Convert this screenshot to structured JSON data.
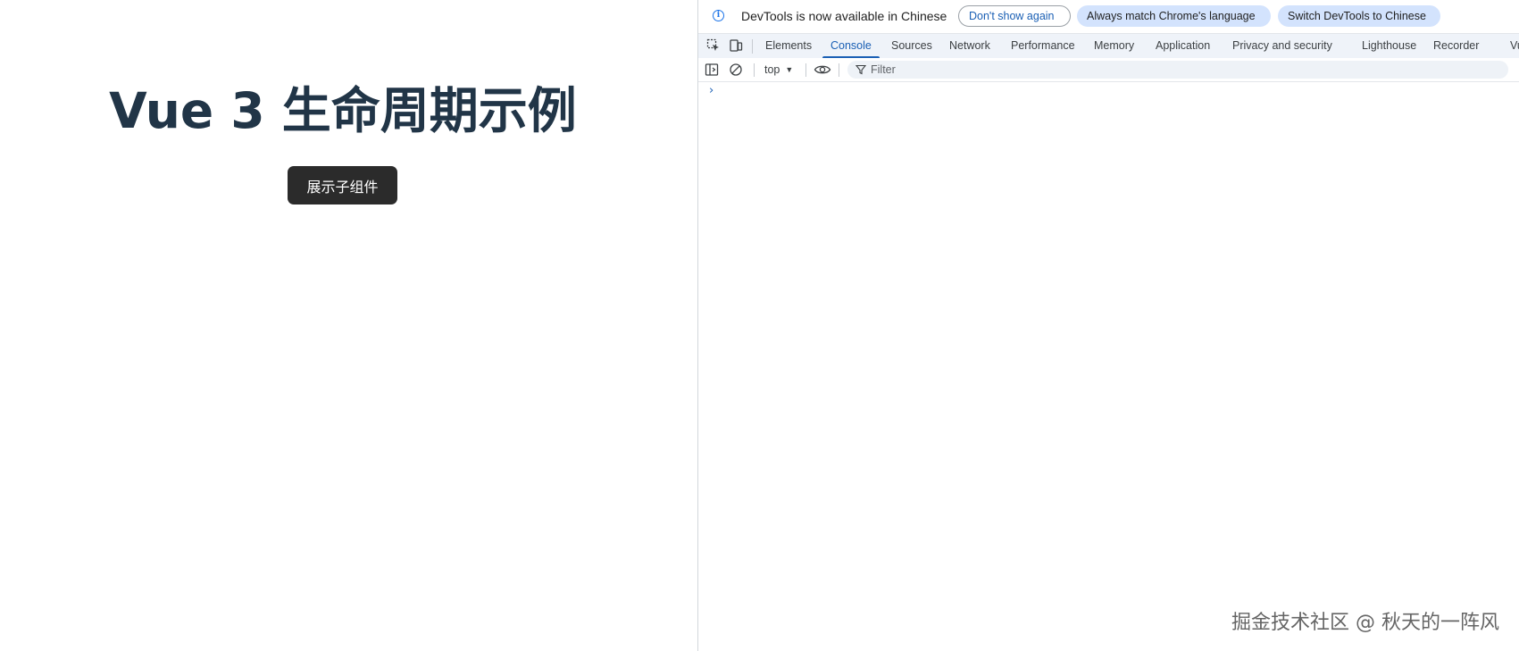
{
  "page": {
    "title": "Vue 3 生命周期示例",
    "button_label": "展示子组件"
  },
  "devtools": {
    "infobar": {
      "message": "DevTools is now available in Chinese",
      "dont_show_again": "Don't show again",
      "always_match": "Always match Chrome's language",
      "switch_language": "Switch DevTools to Chinese"
    },
    "tabs": [
      {
        "label": "Elements"
      },
      {
        "label": "Console",
        "active": true
      },
      {
        "label": "Sources"
      },
      {
        "label": "Network"
      },
      {
        "label": "Performance"
      },
      {
        "label": "Memory"
      },
      {
        "label": "Application"
      },
      {
        "label": "Privacy and security"
      },
      {
        "label": "Lighthouse"
      },
      {
        "label": "Recorder"
      },
      {
        "label": "Vu"
      }
    ],
    "console_toolbar": {
      "context": "top",
      "filter_placeholder": "Filter"
    },
    "prompt": "›"
  },
  "watermark": "掘金技术社区 @ 秋天的一阵风",
  "colors": {
    "title": "#213547",
    "button_bg": "#2b2b2b",
    "accent": "#1a5fb4",
    "pill_bg": "#d3e3fd",
    "tabbar_bg": "#eff3f9"
  }
}
